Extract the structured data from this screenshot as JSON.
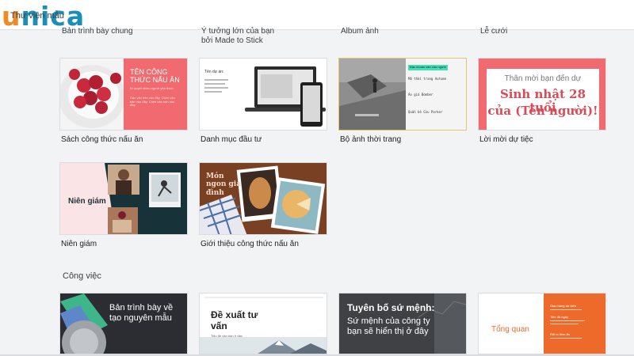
{
  "header": {
    "logo_text": "nica",
    "logo_initial": "u",
    "subtitle": "Thư viện mẫu"
  },
  "prev_row": [
    "Bản trình bày chung",
    "Ý tưởng lớn của bạn",
    "Album ảnh",
    "Lễ cưới"
  ],
  "prev_row_sub": "bởi Made to Stick",
  "templates": [
    {
      "caption": "Sách công thức nấu ăn",
      "title": "TÊN CÔNG THỨC NẤU ĂN",
      "subtitle": "Bí quyết nhiều người yêu thích",
      "body": "Dán văn bản vào đây. Chèn văn bản vào đây. Chèn văn bản vào đây."
    },
    {
      "caption": "Danh mục đầu tư",
      "title": "Tên dự án:"
    },
    {
      "caption": "Bộ ảnh thời trang",
      "highlight": "Đặc khoản văn của người",
      "line1": "Mã thời trang Autumn",
      "line2": "Áo giá Bomber",
      "line3": "Quần bò Cừu Parker"
    },
    {
      "caption": "Lời mời dự tiệc",
      "line1": "Thân mời bạn đến dự",
      "line2": "Sinh nhật 28 tuổi",
      "line3": "của (Tên người)!"
    },
    {
      "caption": "Niên giám",
      "title": "Niên giám"
    },
    {
      "caption": "Giới thiệu công thức nấu ăn",
      "title": "Món ngon gia đình"
    }
  ],
  "section_label": "Công việc",
  "work": [
    {
      "title": "Bản trình bày về tạo nguyên mẫu"
    },
    {
      "title": "Đề xuất tư vấn",
      "sub": "Tiêu đề văn bản ở đây"
    },
    {
      "title": "Tuyên bố sứ mệnh:",
      "body": "Sứ mệnh của công ty bạn sẽ hiển thị ở đây"
    },
    {
      "title": "Tổng quan",
      "h1": "Giao hàng dự kiến",
      "h2": "Tiến độ ngày",
      "h3": "Rủi ro tiềm ẩn"
    }
  ]
}
